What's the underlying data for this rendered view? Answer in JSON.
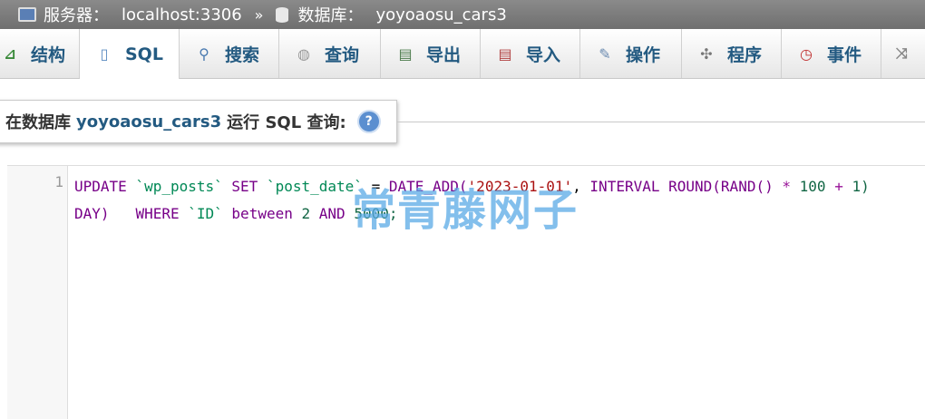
{
  "breadcrumb": {
    "server_label": "服务器：",
    "server_value": "localhost:3306",
    "separator": "»",
    "db_label": "数据库：",
    "db_value": "yoyoaosu_cars3"
  },
  "tabs": [
    {
      "label": "结构",
      "icon": "structure-icon"
    },
    {
      "label": "SQL",
      "icon": "sql-icon"
    },
    {
      "label": "搜索",
      "icon": "search-icon"
    },
    {
      "label": "查询",
      "icon": "query-icon"
    },
    {
      "label": "导出",
      "icon": "export-icon"
    },
    {
      "label": "导入",
      "icon": "import-icon"
    },
    {
      "label": "操作",
      "icon": "wrench-icon"
    },
    {
      "label": "程序",
      "icon": "routines-icon"
    },
    {
      "label": "事件",
      "icon": "events-icon"
    }
  ],
  "query_header": {
    "prefix": "在数据库",
    "db": "yoyoaosu_cars3",
    "suffix": "运行 SQL 查询:"
  },
  "editor": {
    "line_number": "1",
    "tokens": {
      "t1": "UPDATE",
      "t2": "`wp_posts`",
      "t3": "SET",
      "t4": "`post_date`",
      "t5": "=",
      "t6": "DATE_ADD(",
      "t7": "'2023-01-01'",
      "t8": ",",
      "t9": "INTERVAL",
      "t10": "ROUND(RAND()",
      "t11": "*",
      "t12": "100",
      "t13": "+",
      "t14": "1)",
      "t15": "DAY)",
      "t16": "WHERE",
      "t17": "`ID`",
      "t18": "between",
      "t19": "2",
      "t20": "AND",
      "t21": "5000;"
    }
  },
  "watermark": "常青藤网子"
}
